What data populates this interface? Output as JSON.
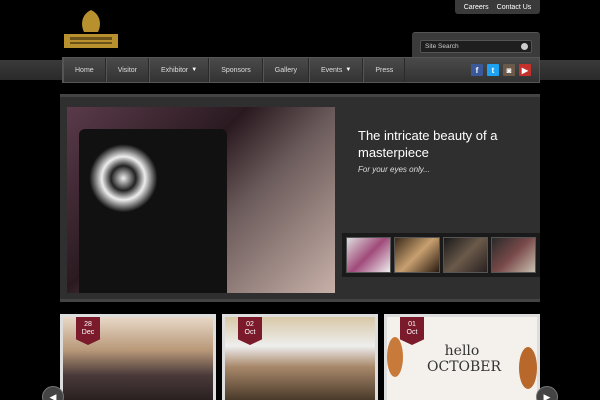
{
  "toplinks": {
    "careers": "Careers",
    "contact": "Contact Us"
  },
  "search": {
    "placeholder": "Site Search"
  },
  "nav": {
    "home": "Home",
    "visitor": "Visitor",
    "exhibitor": "Exhibitor",
    "sponsors": "Sponsors",
    "gallery": "Gallery",
    "events": "Events",
    "press": "Press"
  },
  "social": [
    {
      "icon": "facebook-icon",
      "glyph": "f",
      "color": "#3b5998"
    },
    {
      "icon": "twitter-icon",
      "glyph": "t",
      "color": "#1da1f2"
    },
    {
      "icon": "instagram-icon",
      "glyph": "◙",
      "color": "#6b5a4a"
    },
    {
      "icon": "youtube-icon",
      "glyph": "▶",
      "color": "#c4302b"
    }
  ],
  "slider": {
    "headline": "The intricate beauty of a masterpiece",
    "subline": "For your eyes only..."
  },
  "cards": [
    {
      "day": "28",
      "month": "Dec"
    },
    {
      "day": "02",
      "month": "Oct"
    },
    {
      "day": "01",
      "month": "Oct"
    }
  ],
  "card_image_text": "hello OCTOBER",
  "colors": {
    "accent": "#7a1a2a",
    "background": "#000000",
    "panel": "#2f2f2f"
  }
}
